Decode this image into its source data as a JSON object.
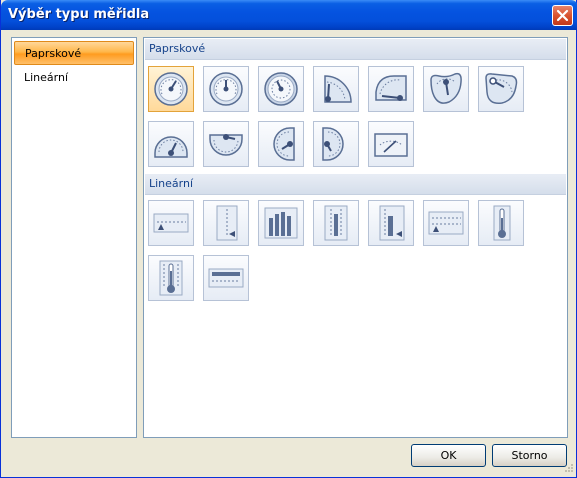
{
  "window": {
    "title": "Výběr typu měřidla"
  },
  "sidebar": {
    "items": [
      {
        "label": "Paprskové",
        "selected": true
      },
      {
        "label": "Lineární",
        "selected": false
      }
    ]
  },
  "gallery": {
    "groups": [
      {
        "label": "Paprskové",
        "tile_count": 12
      },
      {
        "label": "Lineární",
        "tile_count": 9
      }
    ],
    "selected_tile": "radial-gauge-1"
  },
  "buttons": {
    "ok": "OK",
    "cancel": "Storno"
  },
  "colors": {
    "title_bar": "#0553e0",
    "selection": "#ffb74a",
    "group_header_text": "#15428b",
    "tile_border": "#b6c2d6"
  }
}
